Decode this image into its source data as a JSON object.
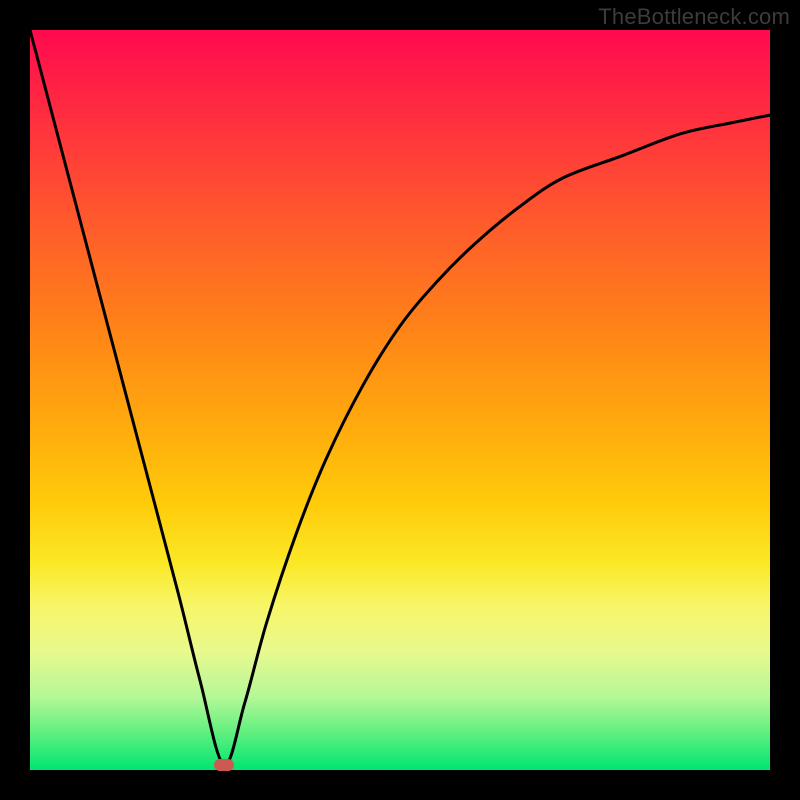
{
  "watermark": "TheBottleneck.com",
  "marker": {
    "x_pct": 26.2,
    "y_pct": 99.3
  },
  "chart_data": {
    "type": "line",
    "title": "",
    "xlabel": "",
    "ylabel": "",
    "xlim": [
      0,
      100
    ],
    "ylim": [
      0,
      100
    ],
    "series": [
      {
        "name": "bottleneck-curve",
        "x": [
          0,
          5,
          10,
          15,
          20,
          23,
          26.2,
          29,
          32,
          36,
          40,
          45,
          50,
          55,
          60,
          66,
          72,
          80,
          88,
          95,
          100
        ],
        "y": [
          100,
          81,
          62,
          43,
          24,
          12,
          0.7,
          9,
          20,
          32,
          42,
          52,
          60,
          66,
          71,
          76,
          80,
          83,
          86,
          87.5,
          88.5
        ]
      }
    ],
    "annotations": [],
    "background_gradient": {
      "stops": [
        {
          "pct": 0,
          "color": "#ff0a4f"
        },
        {
          "pct": 12,
          "color": "#ff2f3f"
        },
        {
          "pct": 26,
          "color": "#ff5a2c"
        },
        {
          "pct": 40,
          "color": "#ff8218"
        },
        {
          "pct": 52,
          "color": "#ffa60e"
        },
        {
          "pct": 64,
          "color": "#ffcb0a"
        },
        {
          "pct": 72,
          "color": "#fbe825"
        },
        {
          "pct": 78,
          "color": "#f7f66a"
        },
        {
          "pct": 84,
          "color": "#e8f98e"
        },
        {
          "pct": 90,
          "color": "#b6f897"
        },
        {
          "pct": 95,
          "color": "#5ff07f"
        },
        {
          "pct": 100,
          "color": "#00e571"
        }
      ]
    }
  }
}
